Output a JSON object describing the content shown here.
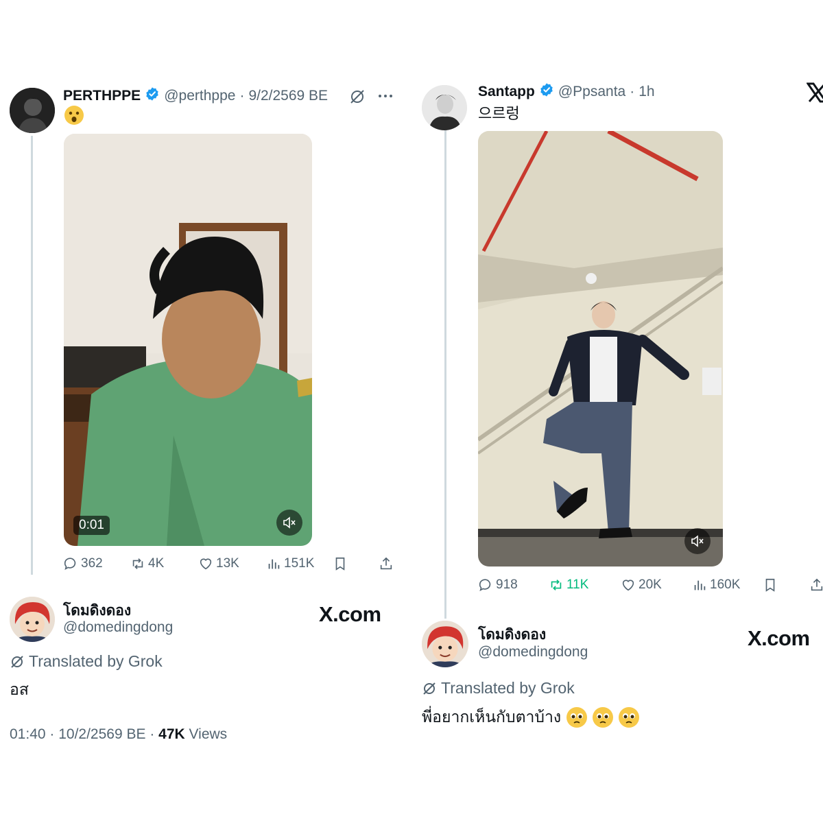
{
  "left_post": {
    "display_name": "PERTHPPE",
    "handle": "@perthppe",
    "date": "9/2/2569 BE",
    "text_emoji": "😯",
    "video_time": "0:01",
    "stats": {
      "replies": "362",
      "reposts": "4K",
      "likes": "13K",
      "views": "151K"
    },
    "quote": {
      "display_name": "โดมดิงดอง",
      "handle": "@domedingdong",
      "translated_by": "Translated by Grok",
      "text": "อส",
      "brand": "X.com"
    },
    "footer": {
      "time_date": "01:40 · 10/2/2569 BE · ",
      "views_count": "47K",
      "views_label": " Views"
    }
  },
  "right_post": {
    "display_name": "Santapp",
    "handle": "@Ppsanta",
    "age": "1h",
    "text": "으르렁",
    "stats": {
      "replies": "918",
      "reposts": "11K",
      "likes": "20K",
      "views": "160K"
    },
    "quote": {
      "display_name": "โดมดิงดอง",
      "handle": "@domedingdong",
      "translated_by": "Translated by Grok",
      "text": "พี่อยากเห็นกับตาบ้าง",
      "brand": "X.com"
    }
  },
  "colors": {
    "verified": "#1d9bf0",
    "repost_active": "#00ba7c",
    "muted": "#536471"
  }
}
